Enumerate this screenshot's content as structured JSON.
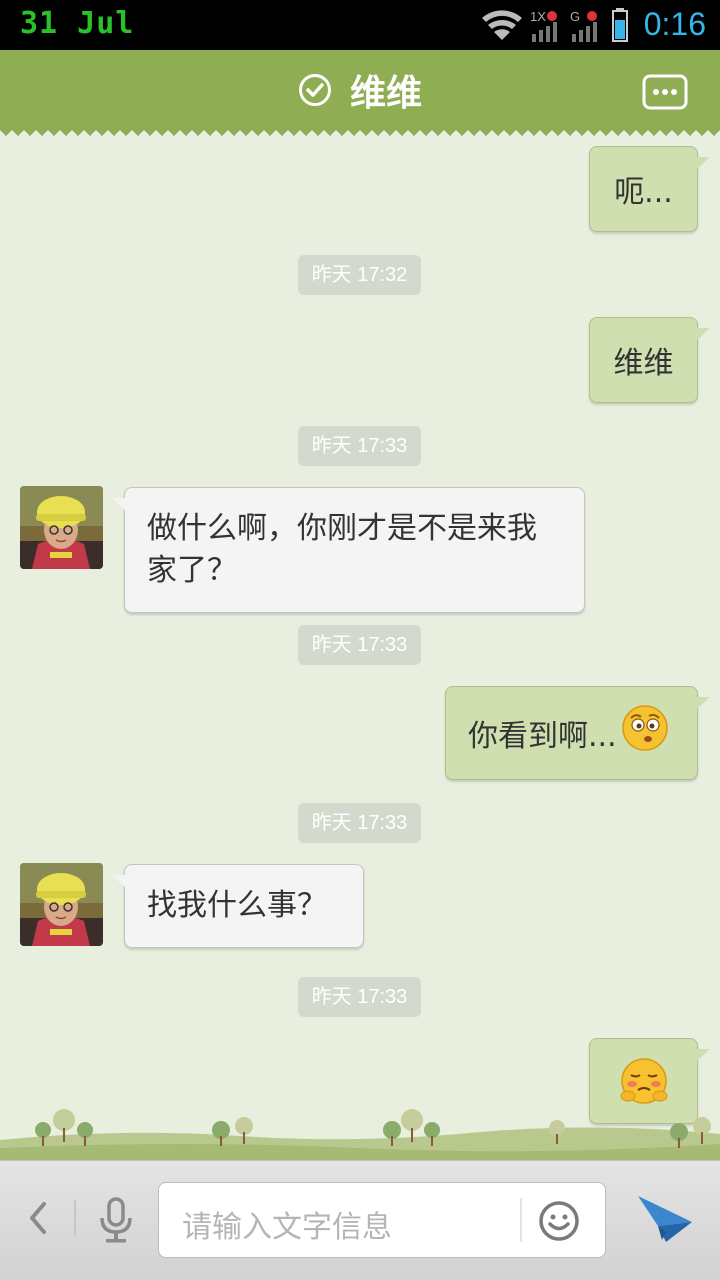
{
  "status_bar": {
    "date": "31 Jul",
    "time": "0:16",
    "icons": [
      "wifi-icon",
      "signal-1x-icon",
      "signal-g-icon",
      "battery-icon"
    ]
  },
  "header": {
    "title": "维维",
    "verified_icon": "check-circle-icon",
    "menu_icon": "more-icon"
  },
  "chat": {
    "messages": [
      {
        "from": "me",
        "text": "呃..."
      },
      {
        "timestamp": "昨天 17:32"
      },
      {
        "from": "me",
        "text": "维维"
      },
      {
        "timestamp": "昨天 17:33"
      },
      {
        "from": "them",
        "text": "做什么啊，你刚才是不是来我家了？"
      },
      {
        "timestamp": "昨天 17:33"
      },
      {
        "from": "me",
        "text": "你看到啊...",
        "emoji": "confused-face"
      },
      {
        "timestamp": "昨天 17:33"
      },
      {
        "from": "them",
        "text": "找我什么事？"
      },
      {
        "timestamp": "昨天 17:33"
      },
      {
        "from": "me",
        "emoji": "shy-face"
      }
    ]
  },
  "input_bar": {
    "placeholder": "请输入文字信息",
    "icons": [
      "back-chevron-icon",
      "microphone-icon",
      "smiley-icon",
      "send-icon"
    ]
  },
  "colors": {
    "header_green": "#8fae54",
    "chat_bg": "#e9efdf",
    "bubble_out": "#cfdfb0",
    "bubble_in": "#f4f4f4"
  }
}
